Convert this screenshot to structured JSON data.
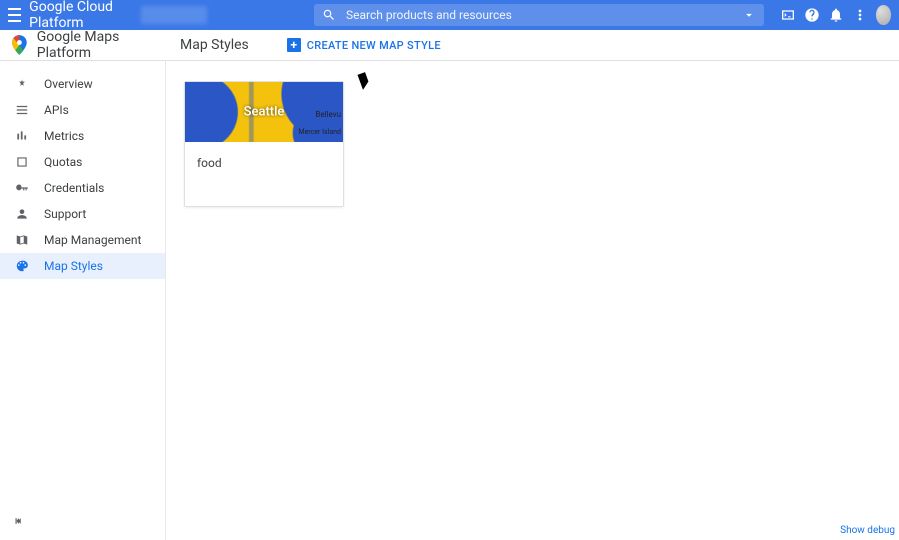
{
  "topbar": {
    "brand": "Google Cloud Platform",
    "search_placeholder": "Search products and resources"
  },
  "header": {
    "product_name": "Google Maps Platform",
    "page_title": "Map Styles",
    "create_label": "CREATE NEW MAP STYLE"
  },
  "sidebar": {
    "items": [
      {
        "label": "Overview"
      },
      {
        "label": "APIs"
      },
      {
        "label": "Metrics"
      },
      {
        "label": "Quotas"
      },
      {
        "label": "Credentials"
      },
      {
        "label": "Support"
      },
      {
        "label": "Map Management"
      },
      {
        "label": "Map Styles"
      }
    ]
  },
  "card": {
    "city": "Seattle",
    "label_a": "Bellevu",
    "label_b": "Mercer Island",
    "name": "food"
  },
  "footer": {
    "show_debug": "Show debug"
  }
}
